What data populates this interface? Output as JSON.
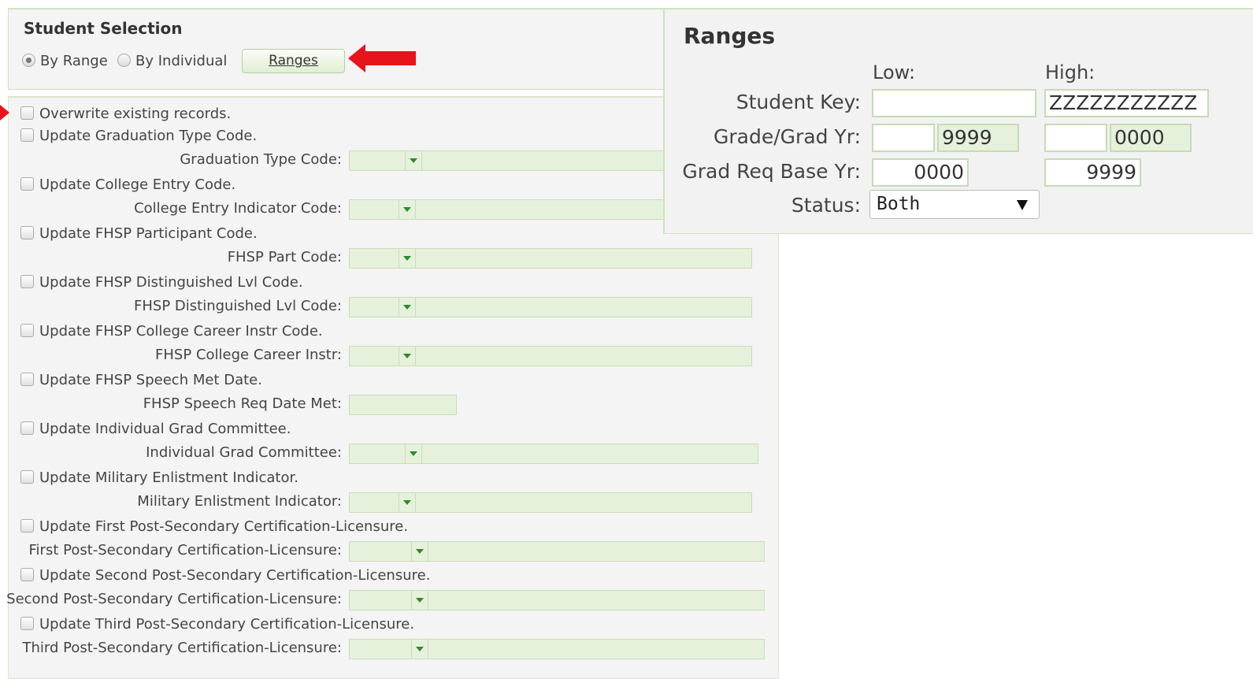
{
  "selection": {
    "title": "Student Selection",
    "by_range_label": "By Range",
    "by_individual_label": "By Individual",
    "selected": "By Range",
    "ranges_button": "Ranges"
  },
  "options": [
    {
      "checkbox": "Overwrite existing records."
    },
    {
      "checkbox": "Update Graduation Type Code.",
      "field": "Graduation Type Code:",
      "kind": "select"
    },
    {
      "checkbox": "Update College Entry Code.",
      "field": "College Entry Indicator Code:",
      "kind": "select"
    },
    {
      "checkbox": "Update FHSP Participant Code.",
      "field": "FHSP Part Code:",
      "kind": "select"
    },
    {
      "checkbox": "Update FHSP Distinguished Lvl Code.",
      "field": "FHSP Distinguished Lvl Code:",
      "kind": "select"
    },
    {
      "checkbox": "Update FHSP College Career Instr Code.",
      "field": "FHSP College Career Instr:",
      "kind": "select"
    },
    {
      "checkbox": "Update FHSP Speech Met Date.",
      "field": "FHSP Speech Req Date Met:",
      "kind": "text"
    },
    {
      "checkbox": "Update Individual Grad Committee.",
      "field": "Individual Grad Committee:",
      "kind": "select"
    },
    {
      "checkbox": "Update Military Enlistment Indicator.",
      "field": "Military Enlistment Indicator:",
      "kind": "select"
    },
    {
      "checkbox": "Update First Post-Secondary Certification-Licensure.",
      "field": "First Post-Secondary Certification-Licensure:",
      "kind": "select"
    },
    {
      "checkbox": "Update Second Post-Secondary Certification-Licensure.",
      "field": "Second Post-Secondary Certification-Licensure:",
      "kind": "select"
    },
    {
      "checkbox": "Update Third Post-Secondary Certification-Licensure.",
      "field": "Third Post-Secondary Certification-Licensure:",
      "kind": "select"
    }
  ],
  "ranges": {
    "title": "Ranges",
    "low_label": "Low:",
    "high_label": "High:",
    "student_key_label": "Student Key:",
    "student_key_low": "",
    "student_key_high": "ZZZZZZZZZZZ",
    "grade_label": "Grade/Grad Yr:",
    "grade_low": "",
    "grad_yr_low": "9999",
    "grade_high": "",
    "grad_yr_high": "0000",
    "grad_req_label": "Grad Req Base Yr:",
    "grad_req_low": "0000",
    "grad_req_high": "9999",
    "status_label": "Status:",
    "status_value": "Both"
  },
  "colors": {
    "panel_border": "#cfe3bf",
    "field_fill": "#e6f1dc",
    "dropdown_arrow": "#2d8a28",
    "annotation_arrow": "#e8141b"
  }
}
